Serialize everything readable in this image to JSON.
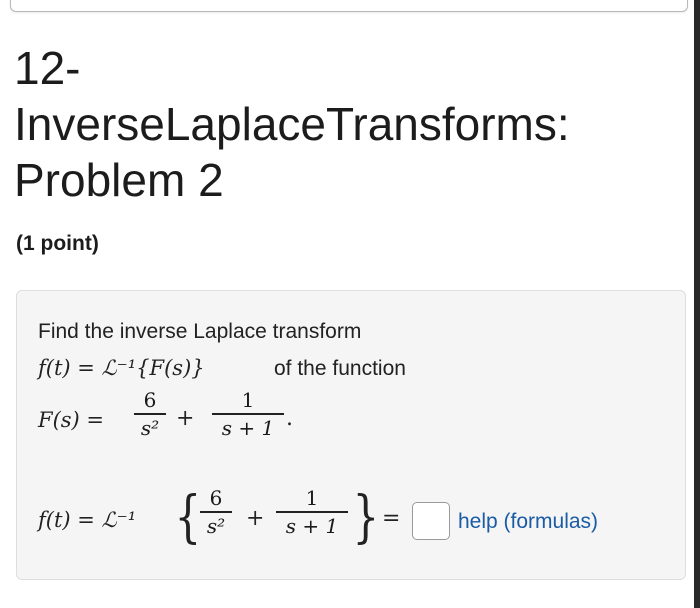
{
  "header": {
    "title_line1": "12-",
    "title_line2": "InverseLaplaceTransforms:",
    "title_line3": "Problem 2",
    "points": "(1 point)"
  },
  "problem": {
    "instruction": "Find the inverse Laplace transform",
    "ft_def": "f(t) = ℒ⁻¹{F(s)}",
    "of_function": "of the function",
    "Fs_lhs": "F(s) =",
    "frac1_num": "6",
    "frac1_den": "s²",
    "plus": "+",
    "frac2_num": "1",
    "frac2_den": "s + 1",
    "period": ".",
    "answer_lhs": "f(t) = ℒ⁻¹",
    "equals": "=",
    "brace_open": "{",
    "brace_close": "}"
  },
  "help": {
    "label": "help (formulas)"
  }
}
